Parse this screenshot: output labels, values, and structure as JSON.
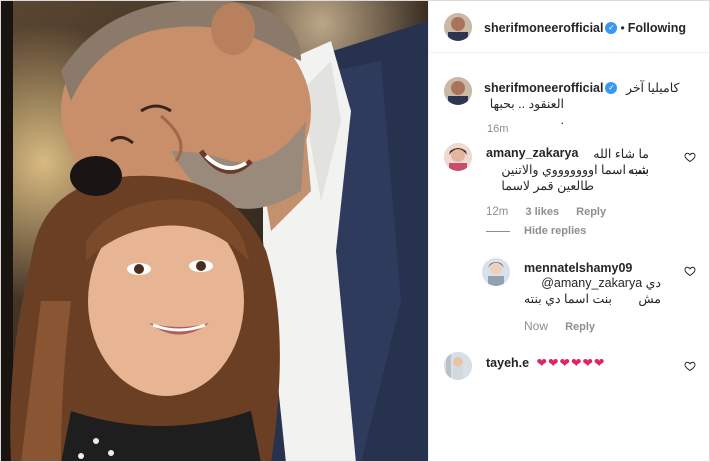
{
  "header": {
    "username": "sherifmoneerofficial",
    "separator": "•",
    "follow_status": "Following"
  },
  "caption": {
    "username": "sherifmoneerofficial",
    "line1": "كاميليا آخر",
    "line2": "العنقود .. بحبها .",
    "time": "16m"
  },
  "comments": [
    {
      "username": "amany_zakarya",
      "text_line1": "ما شاء الله شبه",
      "text_line2": "بنت اسما اوووووووي والاتنين",
      "text_line3": "طالعين قمر لاسما",
      "time": "12m",
      "likes": "3 likes",
      "reply": "Reply",
      "hide_replies": "Hide replies"
    },
    {
      "username": "mennatelshamy09",
      "text_line1": "@amany_zakarya دي مش",
      "text_line2": "بنت اسما دي بنته",
      "time": "Now",
      "reply": "Reply"
    },
    {
      "username": "tayeh.e",
      "text": "❤❤❤❤❤❤"
    }
  ],
  "colors": {
    "verified": "#3897f0",
    "heart_emoji": "#e0245e",
    "muted": "#8e8e8e"
  }
}
